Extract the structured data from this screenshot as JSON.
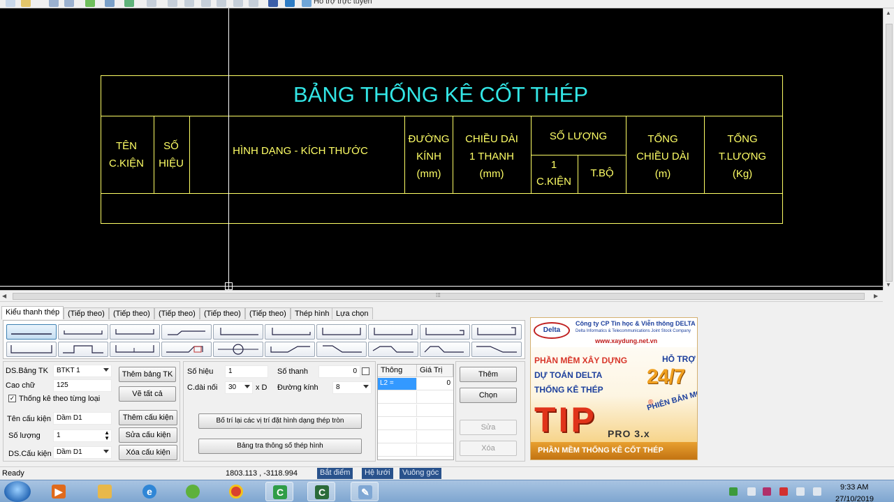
{
  "toolbar": {
    "online_support_label": "Hỗ trợ trực tuyến"
  },
  "drawing": {
    "title": "BẢNG THỐNG KÊ CỐT THÉP",
    "headers": {
      "component_line1": "TÊN",
      "component_line2": "C.KIỆN",
      "mark_line1": "SỐ",
      "mark_line2": "HIỆU",
      "shape": "HÌNH DẠNG - KÍCH THƯỚC",
      "diameter_line1": "ĐƯỜNG",
      "diameter_line2": "KÍNH",
      "diameter_line3": "(mm)",
      "length_line1": "CHIỀU DÀI",
      "length_line2": "1 THANH",
      "length_line3": "(mm)",
      "quantity": "SỐ LƯỢNG",
      "qty_component_line1": "1",
      "qty_component_line2": "C.KIỆN",
      "qty_total": "T.BỘ",
      "total_length_line1": "TỔNG",
      "total_length_line2": "CHIỀU DÀI",
      "total_length_line3": "(m)",
      "total_weight_line1": "TỔNG",
      "total_weight_line2": "T.LƯỢNG",
      "total_weight_line3": "(Kg)"
    }
  },
  "tabs": [
    "Kiểu thanh thép",
    "(Tiếp theo)",
    "(Tiếp theo)",
    "(Tiếp theo)",
    "(Tiếp theo)",
    "(Tiếp theo)",
    "Thép hình",
    "Lựa chọn"
  ],
  "form": {
    "ds_bang_tk_label": "DS.Bảng TK",
    "ds_bang_tk_value": "BTKT 1",
    "cao_chu_label": "Cao chữ",
    "cao_chu_value": "125",
    "thong_ke_label": "Thống kê theo từng loại",
    "them_bang_tk": "Thêm bảng TK",
    "ve_tat_ca": "Vẽ tất cả",
    "ten_cau_kien_label": "Tên cấu kiện",
    "ten_cau_kien_value": "Dầm D1",
    "so_luong_label": "Số lượng",
    "so_luong_value": "1",
    "ds_cau_kien_label": "DS.Cấu kiện",
    "ds_cau_kien_value": "Dầm D1",
    "them_cau_kien": "Thêm cấu kiện",
    "sua_cau_kien": "Sửa cấu kiện",
    "xoa_cau_kien": "Xóa cấu kiện",
    "so_hieu_label": "Số hiệu",
    "so_hieu_value": "1",
    "so_thanh_label": "Số thanh",
    "so_thanh_value": "0",
    "c_dai_noi_label": "C.dài nối",
    "c_dai_noi_value": "30",
    "x_d_label": "x D",
    "duong_kinh_label": "Đường kính",
    "duong_kinh_value": "8",
    "bo_tri_lai": "Bố trí lại các vị trí đặt hình dạng thép tròn",
    "bang_tra": "Bảng tra thông số thép hình",
    "grid_header_1": "Thông",
    "grid_header_2": "Giá Trị",
    "grid_row_1_name": "L2 =",
    "grid_row_1_value": "0",
    "them": "Thêm",
    "chon": "Chọn",
    "sua": "Sửa",
    "xoa": "Xóa"
  },
  "ad": {
    "logo": "Delta",
    "company": "Công ty CP Tin học & Viễn thông DELTA",
    "company_en": "Delta Informatics & Telecommunications Joint Stock Company",
    "website": "www.xaydung.net.vn",
    "line1": "PHẦN MỀM XÂY DỰNG",
    "line2": "DỰ TOÁN DELTA",
    "line3": "THỐNG KÊ THÉP",
    "support": "HỖ TRỢ",
    "support_hours": "24/7",
    "new_version": "PHIÊN BẢN MỚI",
    "product": "TIP",
    "registered": "®",
    "edition": "PRO 3.x",
    "tagline": "PHẦN MỀM THỐNG KÊ CỐT THÉP"
  },
  "status": {
    "ready": "Ready",
    "coordinates": "1803.113 , -3118.994",
    "snap": "Bắt điểm",
    "grid": "Hệ lưới",
    "ortho": "Vuông góc"
  },
  "taskbar": {
    "time": "9:33 AM",
    "date": "27/10/2019"
  },
  "colors": {
    "drawing_bg": "#000000",
    "table_line": "#ffff66",
    "title_text": "#33e6e6",
    "header_text": "#ffff66",
    "crosshair": "#ffffff",
    "status_button": "#29528c"
  }
}
